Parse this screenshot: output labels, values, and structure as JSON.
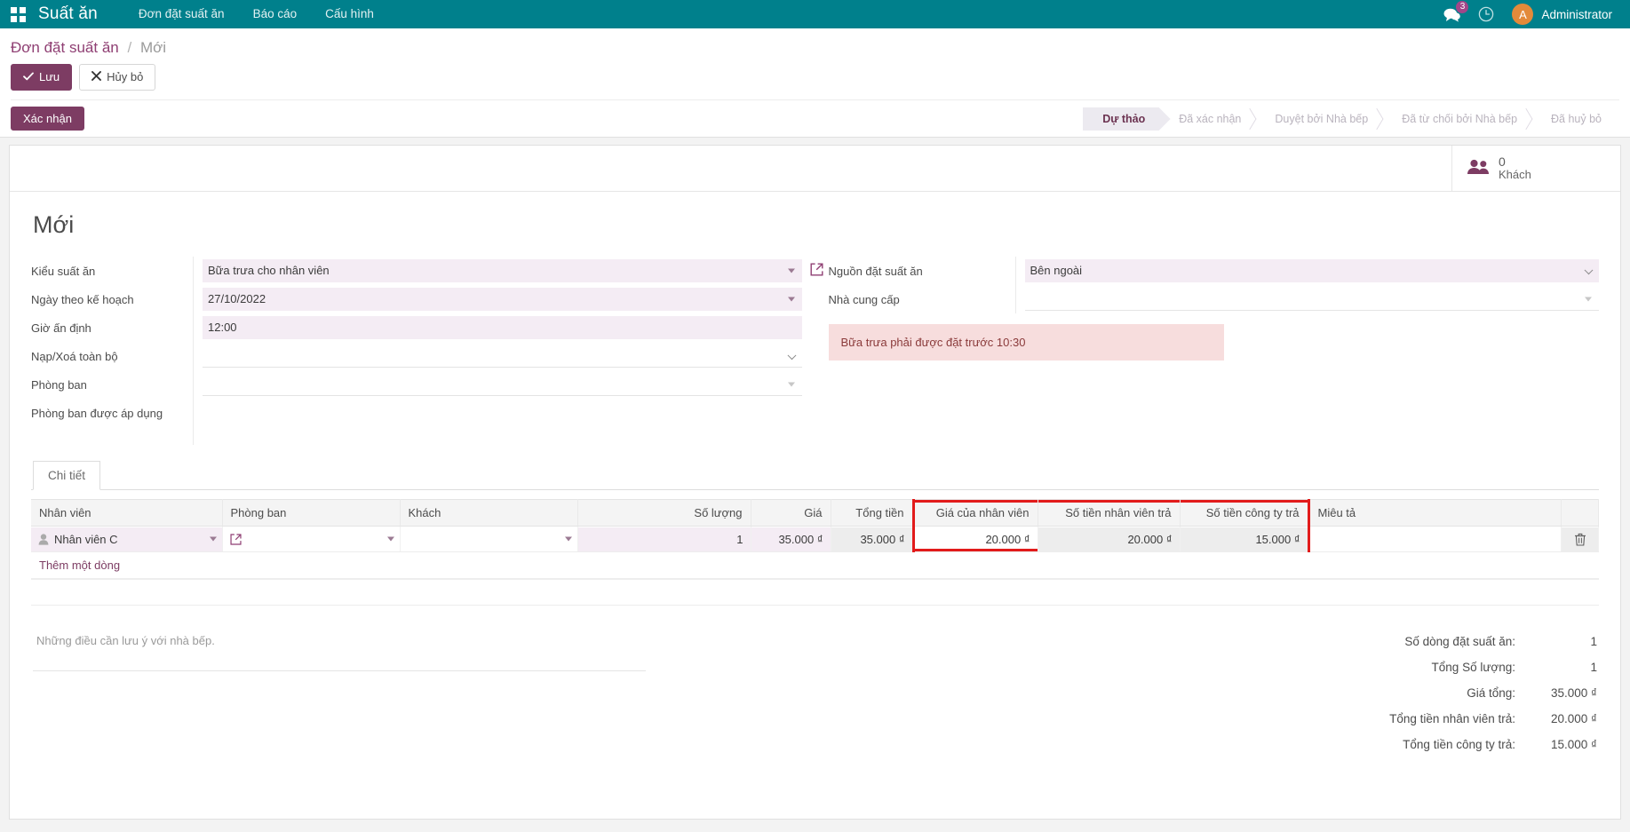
{
  "navbar": {
    "apps_icon": "apps-grid-icon",
    "brand": "Suất ăn",
    "menu": [
      {
        "label": "Đơn đặt suất ăn"
      },
      {
        "label": "Báo cáo"
      },
      {
        "label": "Cấu hình"
      }
    ],
    "messages_icon": "messages-icon",
    "messages_count": "3",
    "activities_icon": "clock-icon",
    "avatar_initial": "A",
    "user_name": "Administrator",
    "bg_color": "#00808c"
  },
  "control_panel": {
    "breadcrumb_root": "Đơn đặt suất ăn",
    "breadcrumb_sep": "/",
    "breadcrumb_current": "Mới",
    "save_label": "Lưu",
    "discard_label": "Hủy bỏ",
    "save_icon": "check-icon",
    "discard_icon": "close-icon",
    "confirm_label": "Xác nhận",
    "statusbar": [
      {
        "label": "Dự thảo",
        "active": true
      },
      {
        "label": "Đã xác nhận",
        "active": false
      },
      {
        "label": "Duyệt bởi Nhà bếp",
        "active": false
      },
      {
        "label": "Đã từ chối bởi Nhà bếp",
        "active": false
      },
      {
        "label": "Đã huỷ bỏ",
        "active": false
      }
    ],
    "accent_color": "#7d3c63"
  },
  "smart_button": {
    "icon": "users-icon",
    "value": "0",
    "label": "Khách"
  },
  "form": {
    "record_title": "Mới",
    "left": {
      "meal_type": {
        "label": "Kiểu suất ăn",
        "value": "Bữa trưa cho nhân viên",
        "internal_link_icon": "external-link-icon"
      },
      "planned_date": {
        "label": "Ngày theo kế hoạch",
        "value": "27/10/2022"
      },
      "fixed_time": {
        "label": "Giờ ấn định",
        "value": "12:00"
      },
      "load_clear": {
        "label": "Nạp/Xoá toàn bộ",
        "value": ""
      },
      "department": {
        "label": "Phòng ban",
        "value": ""
      },
      "applied_department": {
        "label": "Phòng ban được áp dụng",
        "value": ""
      }
    },
    "right": {
      "order_source": {
        "label": "Nguồn đặt suất ăn",
        "value": "Bên ngoài",
        "options": [
          "Bên ngoài"
        ]
      },
      "supplier": {
        "label": "Nhà cung cấp",
        "value": ""
      },
      "alert": {
        "text": "Bữa trưa phải được đặt trước 10:30",
        "bg_color": "#f7dddd",
        "text_color": "#8a3a3a"
      }
    }
  },
  "notebook": {
    "tabs": [
      {
        "label": "Chi tiết",
        "active": true
      }
    ]
  },
  "lines_table": {
    "columns": [
      {
        "key": "employee",
        "label": "Nhân viên",
        "align": "left"
      },
      {
        "key": "department",
        "label": "Phòng ban",
        "align": "left"
      },
      {
        "key": "guest",
        "label": "Khách",
        "align": "left"
      },
      {
        "key": "qty",
        "label": "Số lượng",
        "align": "right"
      },
      {
        "key": "price",
        "label": "Giá",
        "align": "right"
      },
      {
        "key": "subtotal",
        "label": "Tổng tiền",
        "align": "right"
      },
      {
        "key": "employee_price",
        "label": "Giá của nhân viên",
        "align": "right"
      },
      {
        "key": "employee_paid",
        "label": "Số tiền nhân viên trả",
        "align": "right"
      },
      {
        "key": "company_paid",
        "label": "Số tiền công ty trả",
        "align": "right"
      },
      {
        "key": "description",
        "label": "Miêu tả",
        "align": "left"
      }
    ],
    "rows": [
      {
        "employee": "Nhân viên C",
        "employee_icon": "person-icon",
        "employee_ext_icon": "external-link-icon",
        "department": "",
        "guest": "",
        "qty": "1",
        "price": "35.000 ₫",
        "subtotal": "35.000 ₫",
        "employee_price": "20.000 ₫",
        "employee_paid": "20.000 ₫",
        "company_paid": "15.000 ₫",
        "description": "",
        "delete_icon": "trash-icon"
      }
    ],
    "add_line_label": "Thêm một dòng",
    "highlight_color": "#e21b1b",
    "highlighted_columns": [
      "employee_price",
      "employee_paid",
      "company_paid"
    ]
  },
  "footer": {
    "note_placeholder": "Những điều cần lưu ý với nhà bếp.",
    "totals": [
      {
        "label": "Số dòng đặt suất ăn:",
        "value": "1"
      },
      {
        "label": "Tổng Số lượng:",
        "value": "1"
      },
      {
        "label": "Giá tổng:",
        "value": "35.000 ₫"
      },
      {
        "label": "Tổng tiền nhân viên trả:",
        "value": "20.000 ₫"
      },
      {
        "label": "Tổng tiền công ty trả:",
        "value": "15.000 ₫"
      }
    ]
  }
}
